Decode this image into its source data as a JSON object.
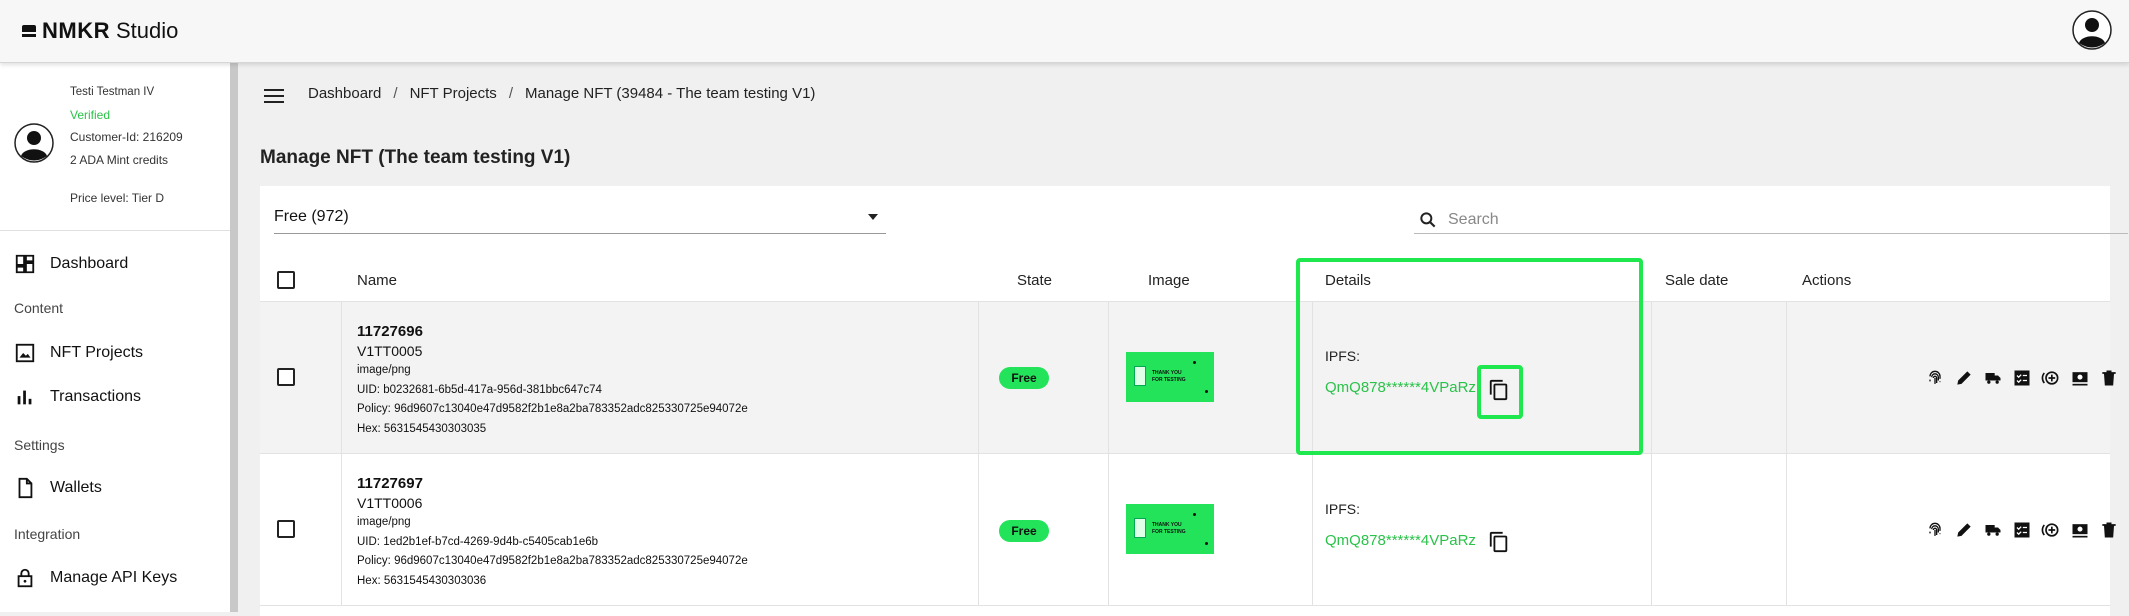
{
  "app": {
    "logo_bold": "NMKR",
    "logo_light": "Studio"
  },
  "profile": {
    "name": "Testi Testman IV",
    "status": "Verified",
    "customer_id": "Customer-Id: 216209",
    "credits": "2 ADA Mint credits",
    "price_level": "Price level: Tier D"
  },
  "sidebar": {
    "dashboard": "Dashboard",
    "section_content": "Content",
    "nft_projects": "NFT Projects",
    "transactions": "Transactions",
    "section_settings": "Settings",
    "wallets": "Wallets",
    "section_integration": "Integration",
    "api_keys": "Manage API Keys"
  },
  "breadcrumb": [
    "Dashboard",
    "NFT Projects",
    "Manage NFT (39484 - The team testing V1)"
  ],
  "page_title": "Manage NFT (The team testing V1)",
  "filter": {
    "selected": "Free (972)"
  },
  "search": {
    "placeholder": "Search"
  },
  "table": {
    "headers": {
      "name": "Name",
      "state": "State",
      "image": "Image",
      "details": "Details",
      "sale_date": "Sale date",
      "actions": "Actions"
    },
    "rows": [
      {
        "id": "11727696",
        "token": "V1TT0005",
        "mime": "image/png",
        "uid": "UID: b0232681-6b5d-417a-956d-381bbc647c74",
        "policy": "Policy: 96d9607c13040e47d9582f2b1e8a2ba783352adc825330725e94072e",
        "hex": "Hex: 5631545430303035",
        "state": "Free",
        "ipfs_label": "IPFS:",
        "ipfs": "QmQ878******4VPaRz",
        "thumb_line1": "THANK YOU",
        "thumb_line2": "FOR TESTING"
      },
      {
        "id": "11727697",
        "token": "V1TT0006",
        "mime": "image/png",
        "uid": "UID: 1ed2b1ef-b7cd-4269-9d4b-c5405cab1e6b",
        "policy": "Policy: 96d9607c13040e47d9582f2b1e8a2ba783352adc825330725e94072e",
        "hex": "Hex: 5631545430303036",
        "state": "Free",
        "ipfs_label": "IPFS:",
        "ipfs": "QmQ878******4VPaRz",
        "thumb_line1": "THANK YOU",
        "thumb_line2": "FOR TESTING"
      }
    ]
  },
  "icons": [
    "logo-icon",
    "account-icon",
    "menu-icon",
    "dashboard-icon",
    "image-icon",
    "bar-chart-icon",
    "file-icon",
    "lock-icon",
    "search-icon",
    "copy-icon",
    "fingerprint-icon",
    "edit-icon",
    "send-icon",
    "checklist-icon",
    "mint-icon",
    "sell-icon",
    "delete-icon"
  ],
  "colors": {
    "accent_green": "#22e35a",
    "link_green": "#2bc24a",
    "highlight": "#1fe84e"
  }
}
